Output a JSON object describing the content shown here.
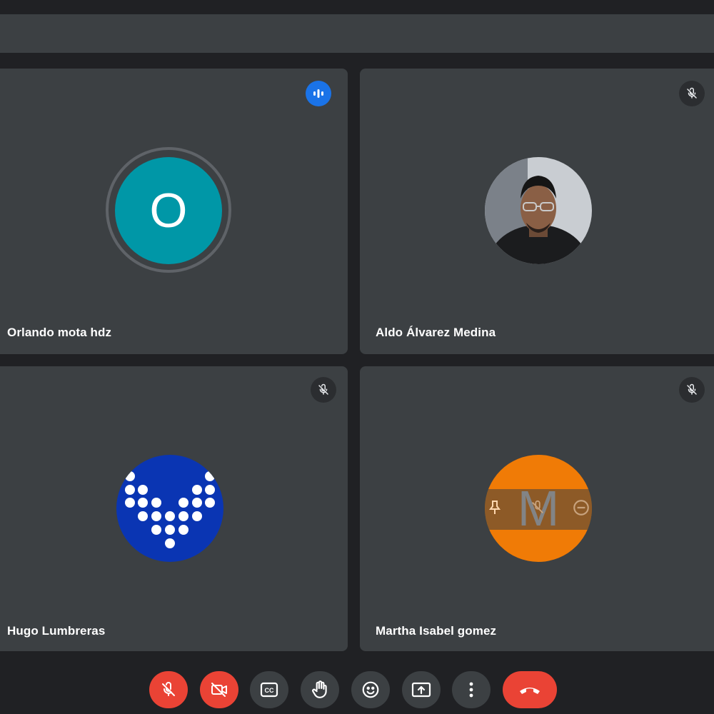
{
  "participants": [
    {
      "name": "Orlando mota hdz",
      "initial": "O",
      "avatar_color": "#0097a7",
      "mic_status": "speaking-icon"
    },
    {
      "name": "Aldo Álvarez Medina",
      "avatar_type": "photo",
      "mic_status": "mic-off-icon"
    },
    {
      "name": "Hugo Lumbreras",
      "avatar_color": "#0a35b3",
      "avatar_type": "dot-logo",
      "mic_status": "mic-off-icon"
    },
    {
      "name": "Martha Isabel gomez",
      "initial": "M",
      "avatar_color": "#f07b06",
      "mic_status": "mic-off-icon"
    }
  ],
  "toolbar": {
    "buttons": [
      {
        "name": "mic-off-button",
        "icon": "mic-off-icon"
      },
      {
        "name": "camera-off-button",
        "icon": "camera-off-icon"
      },
      {
        "name": "captions-button",
        "icon": "cc-icon"
      },
      {
        "name": "raise-hand-button",
        "icon": "hand-icon"
      },
      {
        "name": "reactions-button",
        "icon": "emoji-icon"
      },
      {
        "name": "present-button",
        "icon": "present-icon"
      },
      {
        "name": "more-options-button",
        "icon": "more-vert-icon"
      },
      {
        "name": "end-call-button",
        "icon": "phone-hangup-icon"
      }
    ],
    "colors": {
      "danger": "#ea4335",
      "neutral": "#3c4043"
    }
  }
}
